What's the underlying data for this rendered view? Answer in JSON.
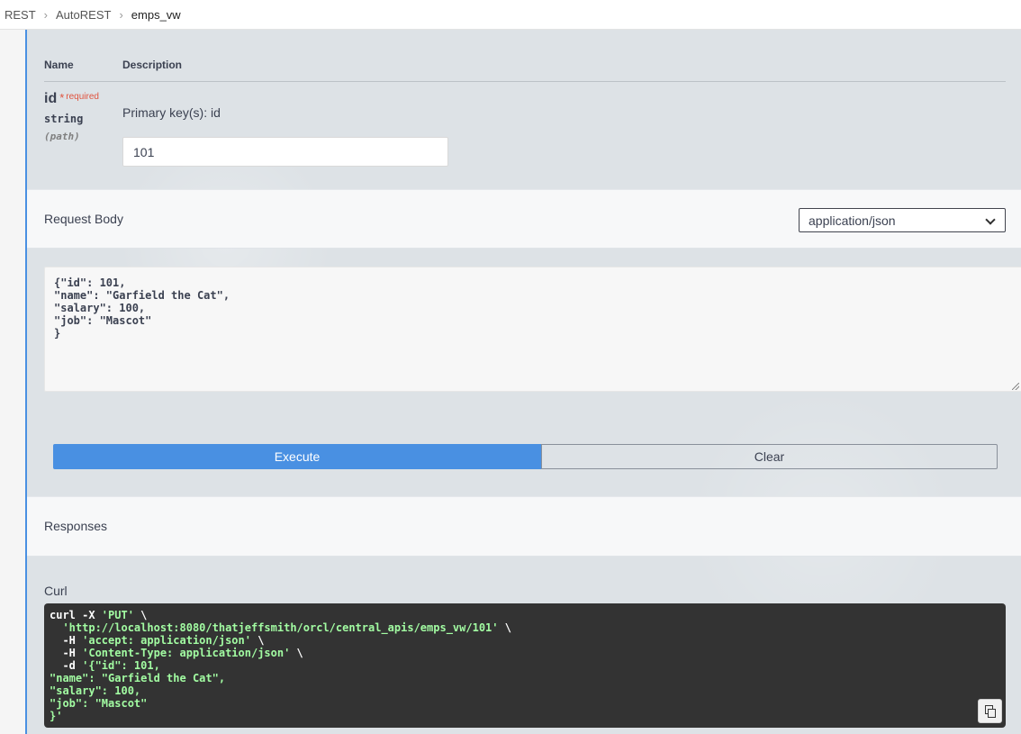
{
  "breadcrumb": {
    "items": [
      "REST",
      "AutoREST",
      "emps_vw"
    ]
  },
  "parameters": {
    "header_name": "Name",
    "header_description": "Description",
    "param": {
      "name": "id",
      "required_mark": "*",
      "required_label": "required",
      "type": "string",
      "location": "(path)",
      "description": "Primary key(s): id",
      "value": "101"
    }
  },
  "request_body": {
    "label": "Request Body",
    "content_type": "application/json",
    "body_text": "{\"id\": 101,\n\"name\": \"Garfield the Cat\",\n\"salary\": 100,\n\"job\": \"Mascot\"\n}"
  },
  "actions": {
    "execute_label": "Execute",
    "clear_label": "Clear"
  },
  "responses": {
    "label": "Responses",
    "curl_label": "Curl",
    "curl_lines": [
      {
        "plain": "curl -X ",
        "green": "'PUT'",
        "tail": " \\"
      },
      {
        "plain": "  ",
        "green": "'http://localhost:8080/thatjeffsmith/orcl/central_apis/emps_vw/101'",
        "tail": " \\"
      },
      {
        "plain": "  -H ",
        "green": "'accept: application/json'",
        "tail": " \\"
      },
      {
        "plain": "  -H ",
        "green": "'Content-Type: application/json'",
        "tail": " \\"
      },
      {
        "plain": "  -d ",
        "green": "'{\"id\": 101,",
        "tail": ""
      },
      {
        "plain": "",
        "green": "\"name\": \"Garfield the Cat\",",
        "tail": ""
      },
      {
        "plain": "",
        "green": "\"salary\": 100,",
        "tail": ""
      },
      {
        "plain": "",
        "green": "\"job\": \"Mascot\"",
        "tail": ""
      },
      {
        "plain": "",
        "green": "}'",
        "tail": ""
      }
    ]
  },
  "colors": {
    "accent": "#4990e2",
    "required": "#e0533e",
    "code_bg": "#333333",
    "code_string": "#a2fca2"
  },
  "icons": {
    "copy": "copy-icon",
    "chevron": "chevron-down-icon",
    "breadcrumb_separator": "chevron-right-icon"
  }
}
